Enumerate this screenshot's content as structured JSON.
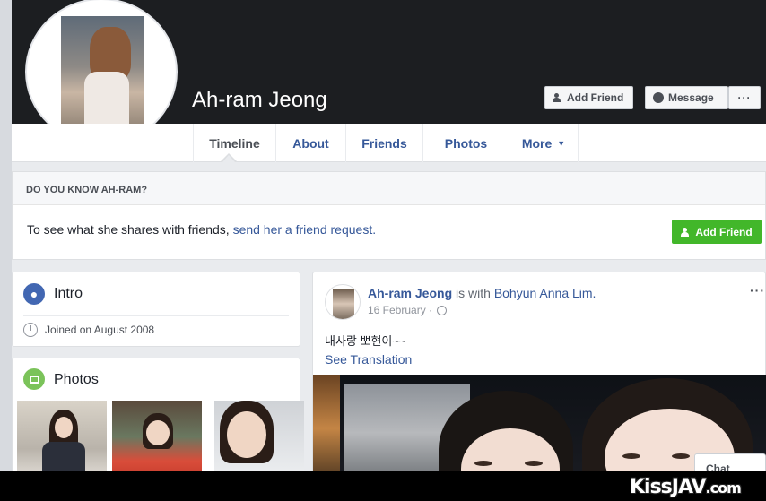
{
  "profile": {
    "name": "Ah-ram Jeong",
    "add_friend_label": "Add Friend",
    "message_label": "Message",
    "more_label": "···"
  },
  "tabs": [
    {
      "label": "Timeline"
    },
    {
      "label": "About"
    },
    {
      "label": "Friends"
    },
    {
      "label": "Photos"
    },
    {
      "label": "More"
    }
  ],
  "know": {
    "heading": "DO YOU KNOW AH-RAM?",
    "text": "To see what she shares with friends, ",
    "link": "send her a friend request.",
    "button_label": "Add Friend"
  },
  "intro": {
    "title": "Intro",
    "joined": "Joined on August 2008"
  },
  "photos": {
    "title": "Photos"
  },
  "post": {
    "author": "Ah-ram Jeong",
    "with_text": " is with ",
    "with_name": "Bohyun Anna Lim.",
    "date": "16 February ·",
    "text": "내사랑 뽀현이~~",
    "see_translation": "See Translation",
    "menu": "···"
  },
  "chat": {
    "label": "Chat"
  },
  "watermark": {
    "main": "KissJAV",
    "suffix": ".com"
  },
  "colors": {
    "link": "#365899",
    "cover": "#1c1e21",
    "green_button": "#42b72a",
    "background": "#e9ebee"
  }
}
